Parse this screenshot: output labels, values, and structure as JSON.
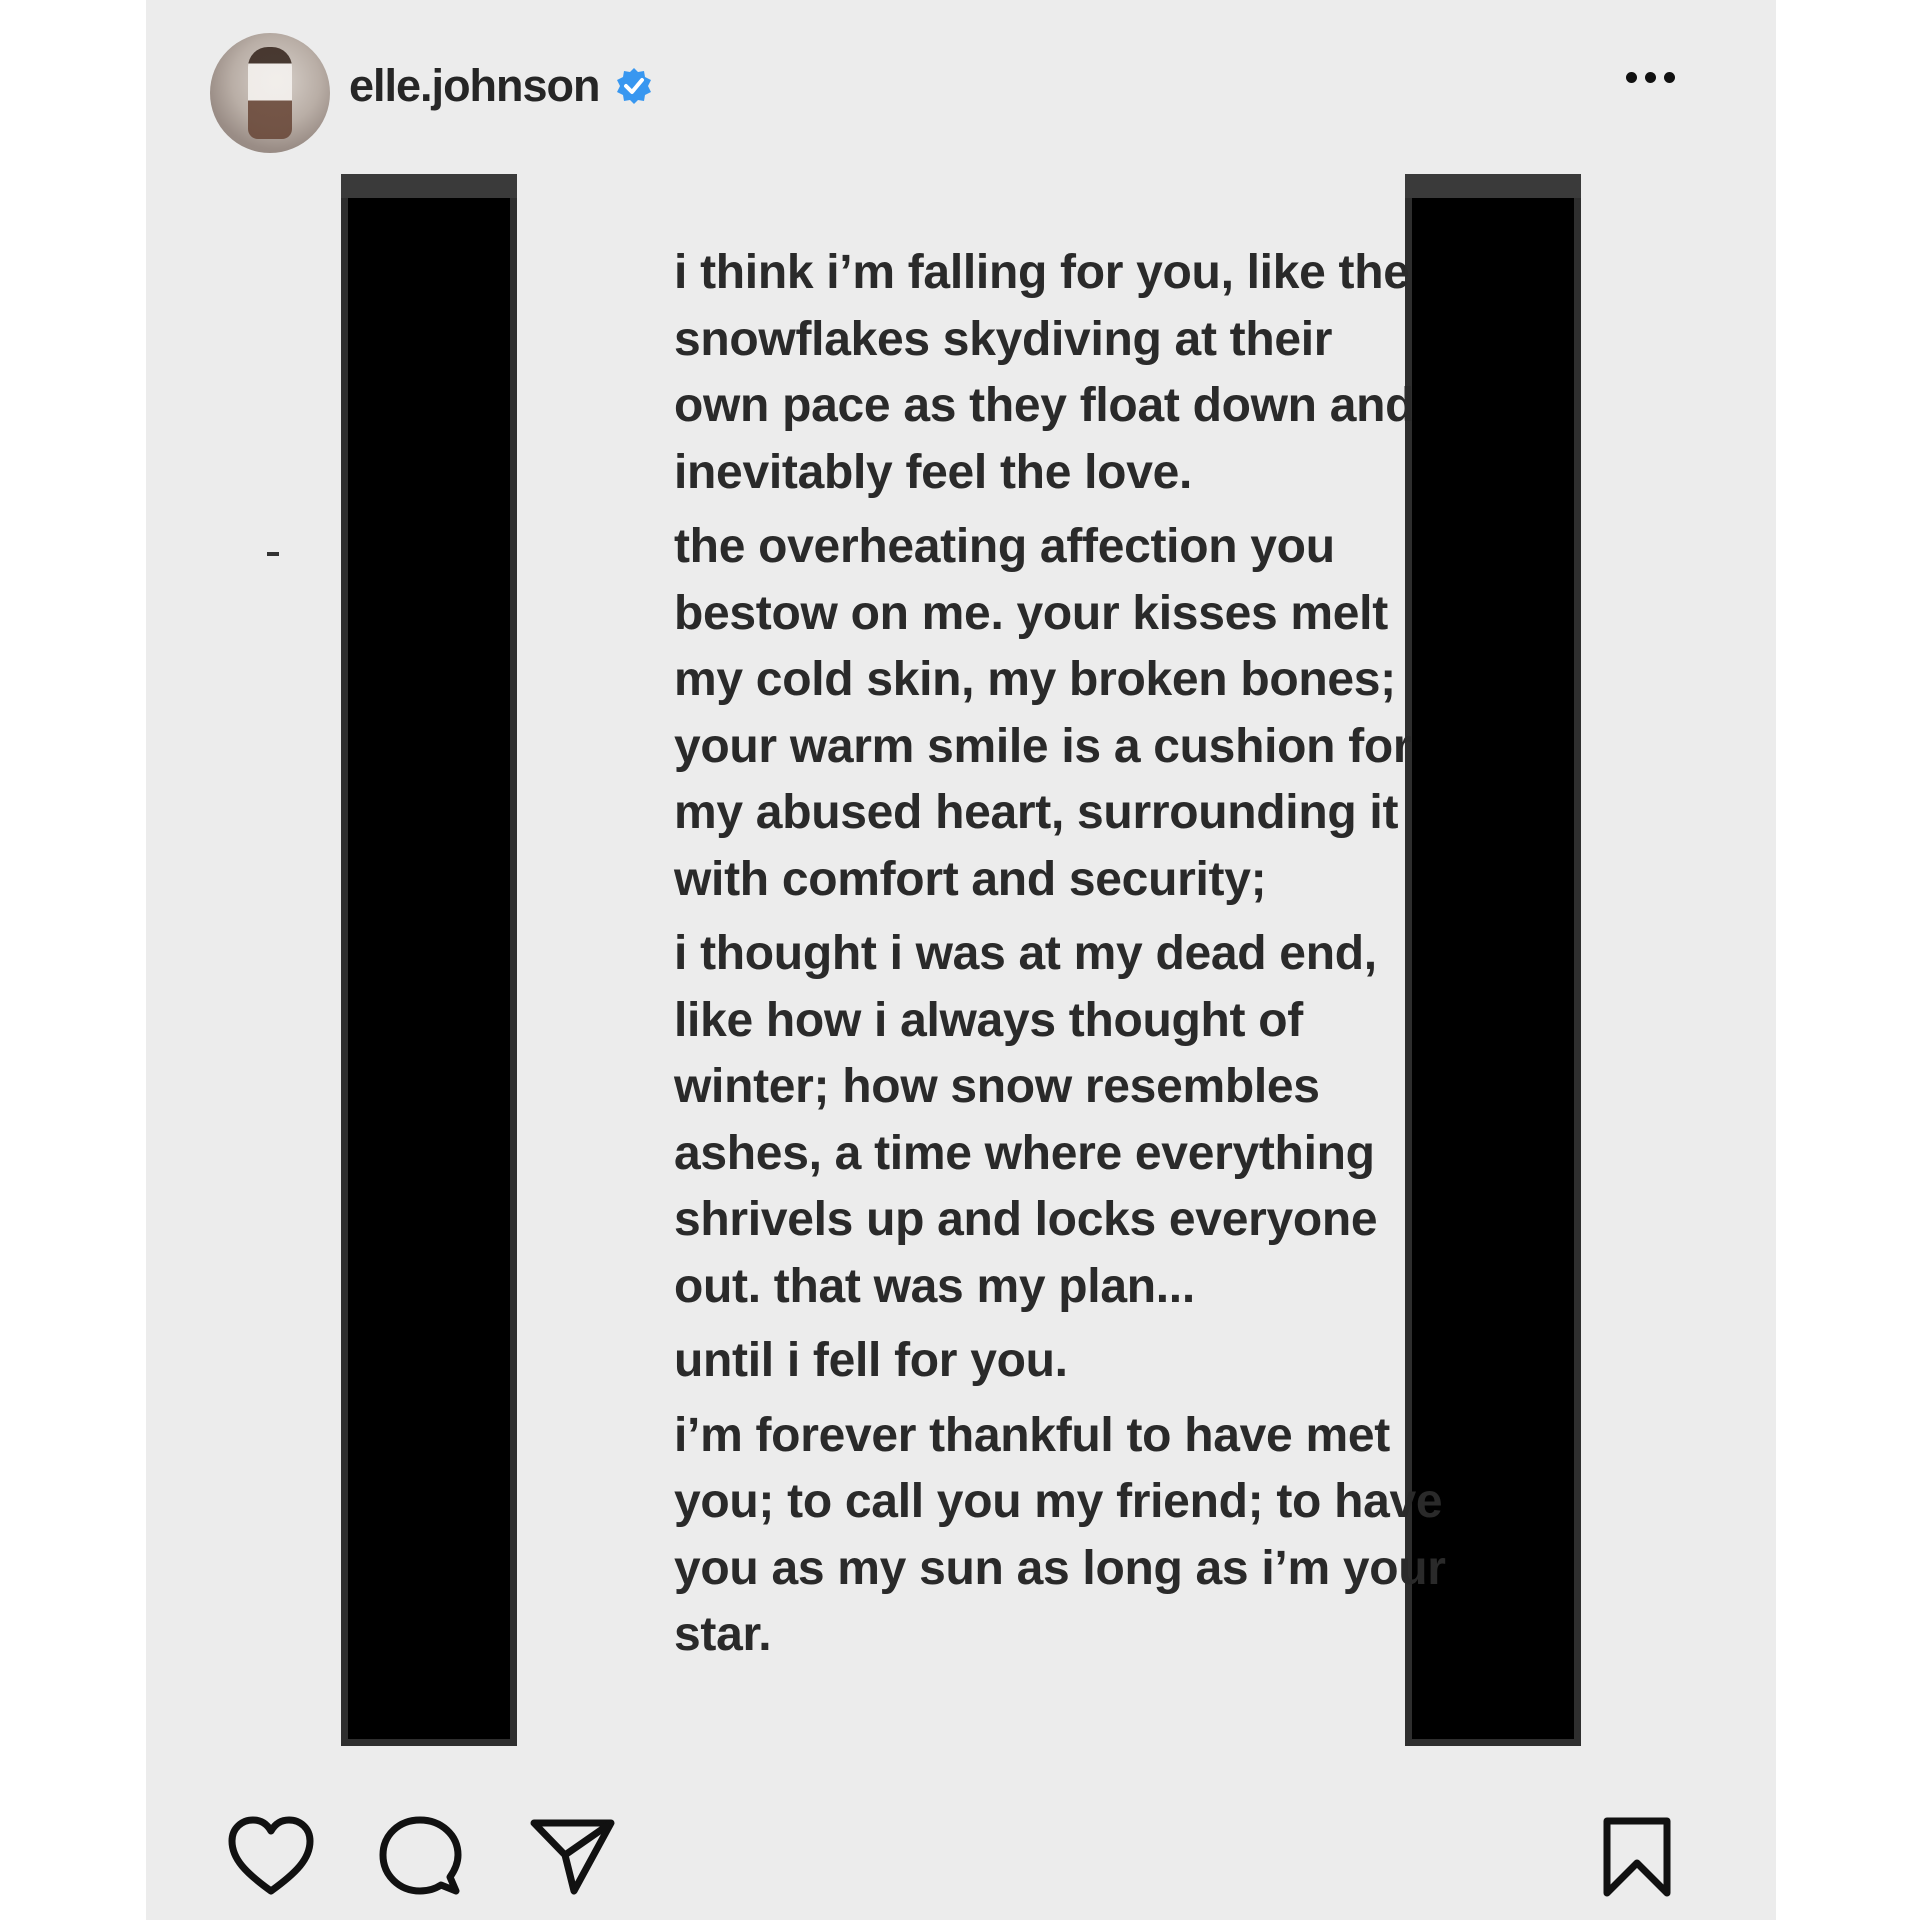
{
  "post": {
    "username": "elle.johnson",
    "verified": true,
    "colors": {
      "background": "#ececec",
      "text": "#2a2a2a",
      "verified_badge": "#3897f0",
      "bars": "#000000"
    },
    "icons": {
      "more": "more-options-icon",
      "like": "heart-icon",
      "comment": "comment-icon",
      "share": "share-icon",
      "save": "bookmark-icon"
    }
  },
  "poem": {
    "paragraphs": [
      {
        "lines": [
          "i think i’m falling for you, like the",
          "snowflakes skydiving at their",
          "own pace as they float down and",
          "inevitably feel the love."
        ]
      },
      {
        "lines": [
          "the overheating affection you",
          "bestow on me. your kisses melt",
          "my cold skin, my broken bones;",
          "your warm smile is a cushion for",
          "my abused heart, surrounding it",
          "with comfort and security;"
        ]
      },
      {
        "lines": [
          "i thought i was at my dead end,",
          "like how i always thought of",
          "winter; how snow resembles",
          "ashes, a time where everything",
          "shrivels up and locks everyone",
          "out. that was my plan..."
        ]
      },
      {
        "lines": [
          "until i fell for you."
        ]
      },
      {
        "lines": [
          "i’m forever thankful to have met",
          "you; to call you my friend; to have",
          "you as my sun as long as i’m your",
          "star."
        ]
      }
    ]
  }
}
